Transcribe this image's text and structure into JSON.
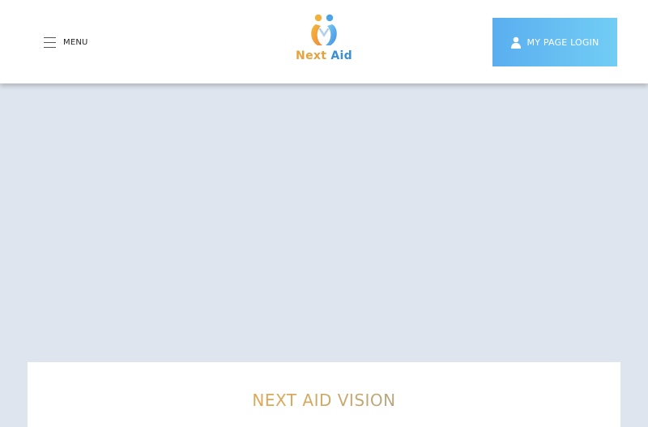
{
  "header": {
    "menu_label": "MENU",
    "logo_text_part1": "Next",
    "logo_text_part2": "Aid",
    "login_label": "MY PAGE LOGIN"
  },
  "vision": {
    "title": "NEXT AID VISION"
  },
  "colors": {
    "logo_orange": "#e7a23e",
    "logo_blue": "#3a8fd6",
    "login_gradient_start": "#5aaef0",
    "login_gradient_end": "#72cdf4",
    "hero_background": "#dfe5ee"
  },
  "icons": {
    "menu": "hamburger-icon",
    "login": "user-icon",
    "logo": "next-aid-logo-mark"
  }
}
